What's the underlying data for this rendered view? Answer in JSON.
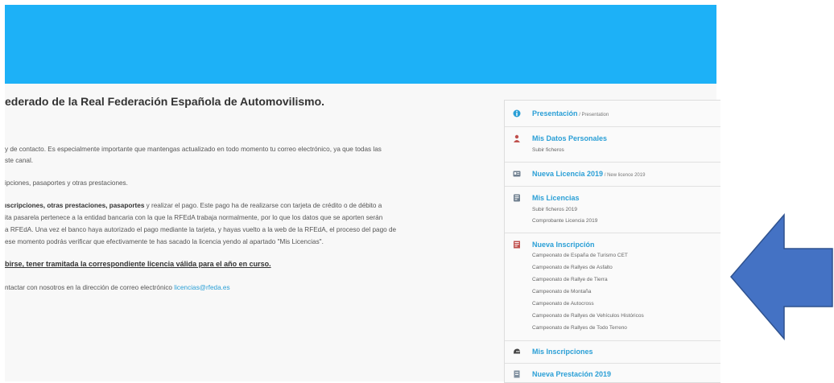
{
  "header": {
    "color": "#1db1f7"
  },
  "main": {
    "heading": "ederado de la Real Federación Española de Automovilismo.",
    "para1_line1": "y de contacto. Es especialmente importante que mantengas actualizado en todo momento tu correo electrónico, ya que todas las",
    "para1_line2": "ste canal.",
    "para2": "ipciones, pasaportes y otras prestaciones.",
    "para3_bold": "ıscripciones, otras prestaciones, pasaportes",
    "para3_rest": " y realizar el pago. Este pago ha de realizarse con tarjeta de crédito o de débito a",
    "para3_line2": "ita pasarela pertenece a la entidad bancaria con la que la RFEdA trabaja normalmente, por lo que los datos que se aporten serán",
    "para3_line3": "a RFEdA. Una vez el banco haya autorizado el pago mediante la tarjeta, y hayas vuelto a la web de la RFEdA, el proceso del pago de",
    "para3_line4": "ese momento podrás verificar que efectivamente te has sacado la licencia yendo al apartado \"Mis Licencias\".",
    "underline_text": "birse, tener tramitada la correspondiente licencia válida para el año en curso.",
    "contact_text": "ntactar con nosotros en la dirección de correo electrónico ",
    "contact_email": "licencias@rfeda.es"
  },
  "sidebar": {
    "presentacion": {
      "title": "Presentación",
      "sep": " / ",
      "sub": "Presentation"
    },
    "datos": {
      "title": "Mis Datos Personales",
      "items": [
        "Subir ficheros"
      ]
    },
    "nueva_licencia": {
      "title": "Nueva Licencia 2019",
      "sep": " / ",
      "sub": "New licence 2019"
    },
    "licencias": {
      "title": "Mis Licencias",
      "items": [
        "Subir ficheros 2019",
        "Comprobante Licencia 2019"
      ]
    },
    "inscripcion": {
      "title": "Nueva Inscripción",
      "items": [
        "Campeonato de España de Turismo CET",
        "Campeonato de Rallyes de Asfalto",
        "Campeonato de Rallye de Tierra",
        "Campeonato de Montaña",
        "Campeonato de Autocross",
        "Campeonato de Rallyes de Vehículos Históricos",
        "Campeonato de Rallyes de Todo Terreno"
      ]
    },
    "mis_inscripciones": {
      "title": "Mis Inscripciones"
    },
    "nueva_prestacion": {
      "title": "Nueva Prestación 2019"
    }
  },
  "annotation": {
    "arrow_color": "#4472c4",
    "arrow_direction": "left"
  }
}
